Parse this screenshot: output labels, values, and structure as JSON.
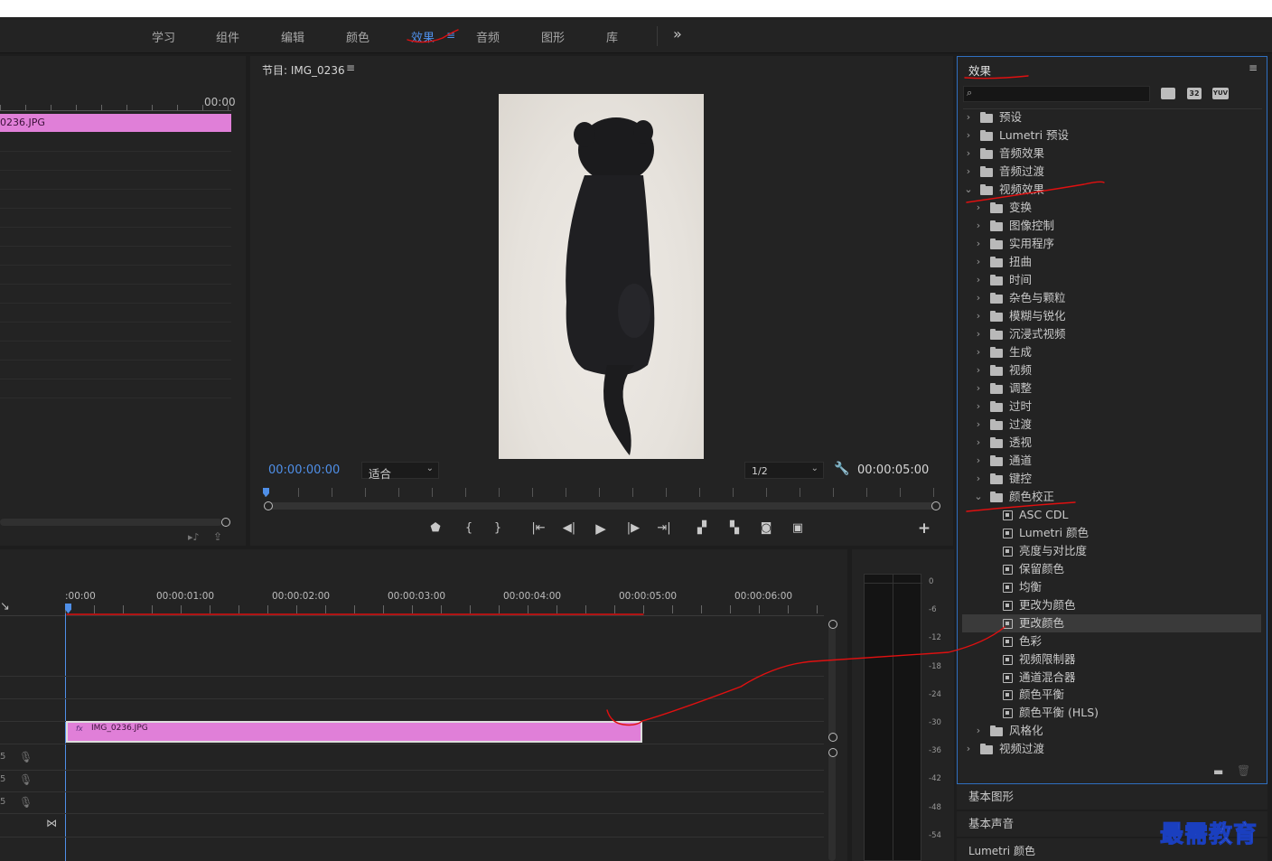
{
  "workspace": {
    "tabs": [
      {
        "label": "学习"
      },
      {
        "label": "组件"
      },
      {
        "label": "编辑"
      },
      {
        "label": "颜色"
      },
      {
        "label": "效果"
      },
      {
        "label": "音频"
      },
      {
        "label": "图形"
      },
      {
        "label": "库"
      }
    ],
    "more_icon": "chevron-double-right-icon"
  },
  "source": {
    "timecode": "00:00",
    "clip_label": "0236.JPG"
  },
  "program": {
    "title": "节目: IMG_0236",
    "current_time": "00:00:00:00",
    "fit_select": "适合",
    "resolution_select": "1/2",
    "duration": "00:00:05:00",
    "image_subject": "black-dog-photo"
  },
  "timeline": {
    "ruler_labels": [
      ":00:00",
      "00:00:01:00",
      "00:00:02:00",
      "00:00:03:00",
      "00:00:04:00",
      "00:00:05:00",
      "00:00:06:00"
    ],
    "clip_name": "IMG_0236.JPG",
    "clip_badge": "fx",
    "track_labels": [
      "5",
      "5",
      "5"
    ]
  },
  "meter": {
    "scale": [
      "0",
      "-6",
      "-12",
      "-18",
      "-24",
      "-30",
      "-36",
      "-42",
      "-48",
      "-54"
    ]
  },
  "effects": {
    "title": "效果",
    "search_placeholder": "",
    "toggle_badges": [
      "32",
      "YUV"
    ],
    "tree": [
      {
        "label": "预设",
        "level": 0,
        "type": "preset",
        "expanded": false
      },
      {
        "label": "Lumetri 预设",
        "level": 0,
        "type": "preset",
        "expanded": false
      },
      {
        "label": "音频效果",
        "level": 0,
        "type": "folder",
        "expanded": false
      },
      {
        "label": "音频过渡",
        "level": 0,
        "type": "folder",
        "expanded": false
      },
      {
        "label": "视频效果",
        "level": 0,
        "type": "folder",
        "expanded": true
      },
      {
        "label": "变换",
        "level": 1,
        "type": "folder",
        "expanded": false
      },
      {
        "label": "图像控制",
        "level": 1,
        "type": "folder",
        "expanded": false
      },
      {
        "label": "实用程序",
        "level": 1,
        "type": "folder",
        "expanded": false
      },
      {
        "label": "扭曲",
        "level": 1,
        "type": "folder",
        "expanded": false
      },
      {
        "label": "时间",
        "level": 1,
        "type": "folder",
        "expanded": false
      },
      {
        "label": "杂色与颗粒",
        "level": 1,
        "type": "folder",
        "expanded": false
      },
      {
        "label": "模糊与锐化",
        "level": 1,
        "type": "folder",
        "expanded": false
      },
      {
        "label": "沉浸式视频",
        "level": 1,
        "type": "folder",
        "expanded": false
      },
      {
        "label": "生成",
        "level": 1,
        "type": "folder",
        "expanded": false
      },
      {
        "label": "视频",
        "level": 1,
        "type": "folder",
        "expanded": false
      },
      {
        "label": "调整",
        "level": 1,
        "type": "folder",
        "expanded": false
      },
      {
        "label": "过时",
        "level": 1,
        "type": "folder",
        "expanded": false
      },
      {
        "label": "过渡",
        "level": 1,
        "type": "folder",
        "expanded": false
      },
      {
        "label": "透视",
        "level": 1,
        "type": "folder",
        "expanded": false
      },
      {
        "label": "通道",
        "level": 1,
        "type": "folder",
        "expanded": false
      },
      {
        "label": "键控",
        "level": 1,
        "type": "folder",
        "expanded": false
      },
      {
        "label": "颜色校正",
        "level": 1,
        "type": "folder",
        "expanded": true
      },
      {
        "label": "ASC CDL",
        "level": 2,
        "type": "effect"
      },
      {
        "label": "Lumetri 颜色",
        "level": 2,
        "type": "effect"
      },
      {
        "label": "亮度与对比度",
        "level": 2,
        "type": "effect"
      },
      {
        "label": "保留颜色",
        "level": 2,
        "type": "effect"
      },
      {
        "label": "均衡",
        "level": 2,
        "type": "effect"
      },
      {
        "label": "更改为颜色",
        "level": 2,
        "type": "effect"
      },
      {
        "label": "更改颜色",
        "level": 2,
        "type": "effect",
        "selected": true
      },
      {
        "label": "色彩",
        "level": 2,
        "type": "effect"
      },
      {
        "label": "视频限制器",
        "level": 2,
        "type": "effect"
      },
      {
        "label": "通道混合器",
        "level": 2,
        "type": "effect"
      },
      {
        "label": "颜色平衡",
        "level": 2,
        "type": "effect"
      },
      {
        "label": "颜色平衡 (HLS)",
        "level": 2,
        "type": "effect"
      },
      {
        "label": "风格化",
        "level": 1,
        "type": "folder",
        "expanded": false
      },
      {
        "label": "视频过渡",
        "level": 0,
        "type": "folder",
        "expanded": false
      }
    ]
  },
  "side_panels": [
    "基本图形",
    "基本声音",
    "Lumetri 颜色"
  ],
  "watermark": {
    "text": "最需教育"
  },
  "colors": {
    "accent_blue": "#4f8fe8",
    "clip_pink": "#e07fd8",
    "annotation_red": "#e01010"
  }
}
